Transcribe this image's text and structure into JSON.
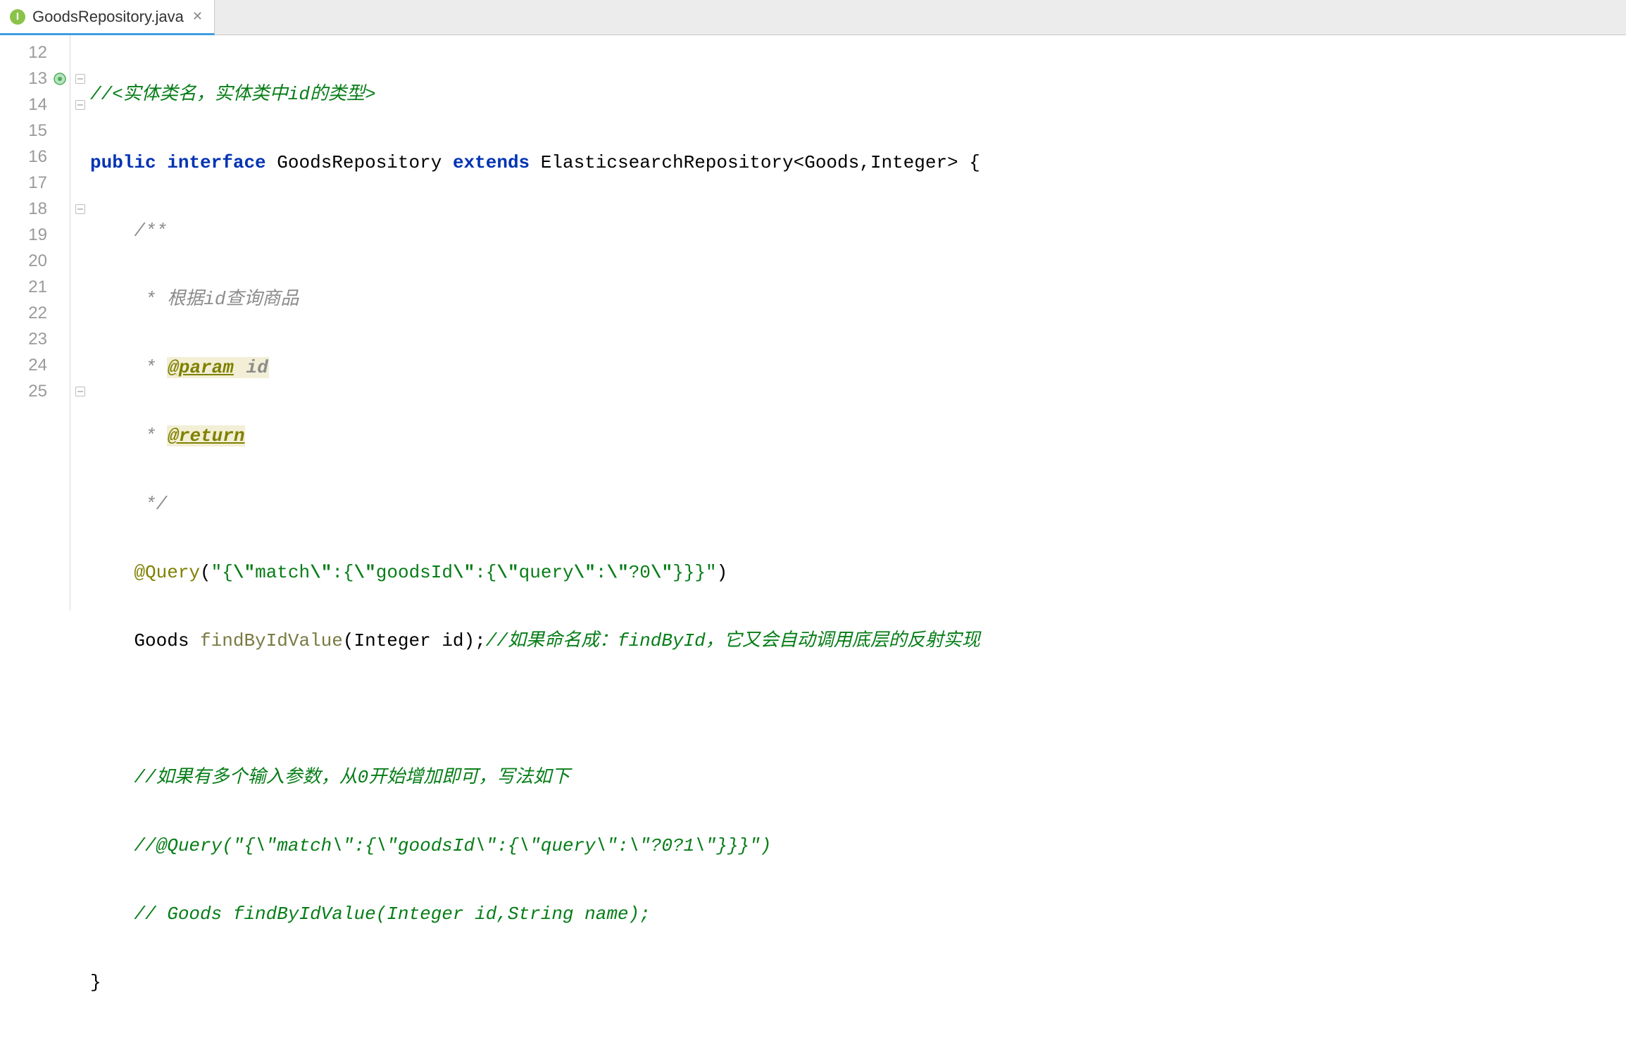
{
  "tab": {
    "icon_letter": "I",
    "filename": "GoodsRepository.java"
  },
  "lines": {
    "first": 12,
    "last": 25,
    "class_marker_line": 13
  },
  "code": {
    "l12_comment": "//<实体类名，实体类中id的类型>",
    "l13_public": "public",
    "l13_interface": "interface",
    "l13_name": "GoodsRepository",
    "l13_extends": "extends",
    "l13_parent": "ElasticsearchRepository<Goods,Integer> {",
    "l14": "/**",
    "l15": " * 根据id查询商品",
    "l16_pre": " * ",
    "l16_tag": "@param",
    "l16_id": " id",
    "l17_pre": " * ",
    "l17_tag": "@return",
    "l18": " */",
    "l19_anno": "@Query",
    "l19_paren_open": "(",
    "l19_str_q1": "\"{",
    "l19_esc1": "\\\"",
    "l19_match": "match",
    "l19_esc2": "\\\"",
    "l19_mid1": ":{",
    "l19_esc3": "\\\"",
    "l19_goods": "goodsId",
    "l19_esc4": "\\\"",
    "l19_mid2": ":{",
    "l19_esc5": "\\\"",
    "l19_query": "query",
    "l19_esc6": "\\\"",
    "l19_mid3": ":",
    "l19_esc7": "\\\"",
    "l19_q0": "?0",
    "l19_esc8": "\\\"",
    "l19_end": "}}}\"",
    "l19_paren_close": ")",
    "l20_type": "Goods ",
    "l20_method": "findByIdValue",
    "l20_params": "(Integer id);",
    "l20_comment": "//如果命名成：findById，它又会自动调用底层的反射实现",
    "l22": "//如果有多个输入参数，从0开始增加即可，写法如下",
    "l23": "//@Query(\"{\\\"match\\\":{\\\"goodsId\\\":{\\\"query\\\":\\\"?0?1\\\"}}}\")",
    "l24": "// Goods findByIdValue(Integer id,String name);",
    "l25": "}"
  }
}
